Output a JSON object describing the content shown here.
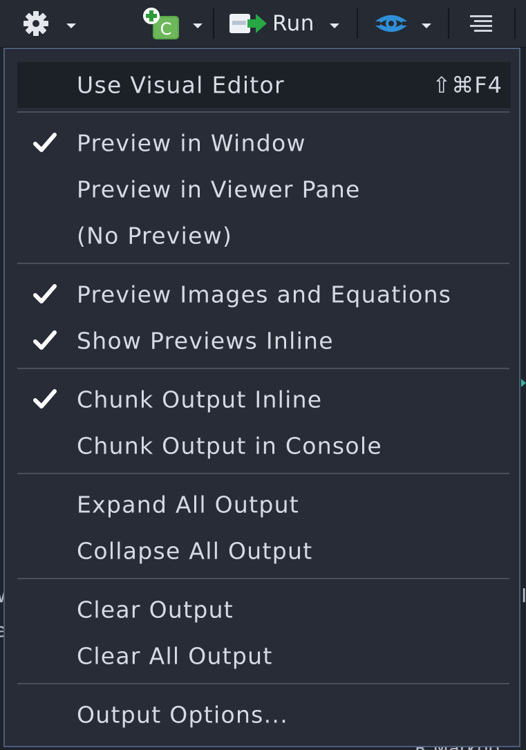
{
  "toolbar": {
    "run_label": "Run",
    "icons": [
      "gear-icon",
      "insert-chunk-icon",
      "run-icon",
      "publish-icon",
      "outline-icon"
    ],
    "chunk_badge": "C"
  },
  "menu": {
    "items": [
      {
        "label": "Use Visual Editor",
        "shortcut": "⇧⌘F4",
        "checked": false
      },
      {
        "label": "Preview in Window",
        "checked": true
      },
      {
        "label": "Preview in Viewer Pane",
        "checked": false
      },
      {
        "label": "(No Preview)",
        "checked": false
      },
      {
        "label": "Preview Images and Equations",
        "checked": true
      },
      {
        "label": "Show Previews Inline",
        "checked": true
      },
      {
        "label": "Chunk Output Inline",
        "checked": true
      },
      {
        "label": "Chunk Output in Console",
        "checked": false
      },
      {
        "label": "Expand All Output",
        "checked": false
      },
      {
        "label": "Collapse All Output",
        "checked": false
      },
      {
        "label": "Clear Output",
        "checked": false
      },
      {
        "label": "Clear All Output",
        "checked": false
      },
      {
        "label": "Output Options...",
        "checked": false
      }
    ]
  },
  "background": {
    "left_fragment_1": "W",
    "left_fragment_2": "e",
    "right_fragment": "I",
    "bottom_fragment": "R Markdo"
  },
  "colors": {
    "menu_bg": "#272c36",
    "menu_border": "#4d5d78",
    "text": "#d5dae3",
    "check": "#ffffff",
    "highlight_bg": "#1c2027",
    "divider": "#4a505c",
    "accent_green": "#3cb043",
    "accent_blue": "#2f8fd8"
  }
}
